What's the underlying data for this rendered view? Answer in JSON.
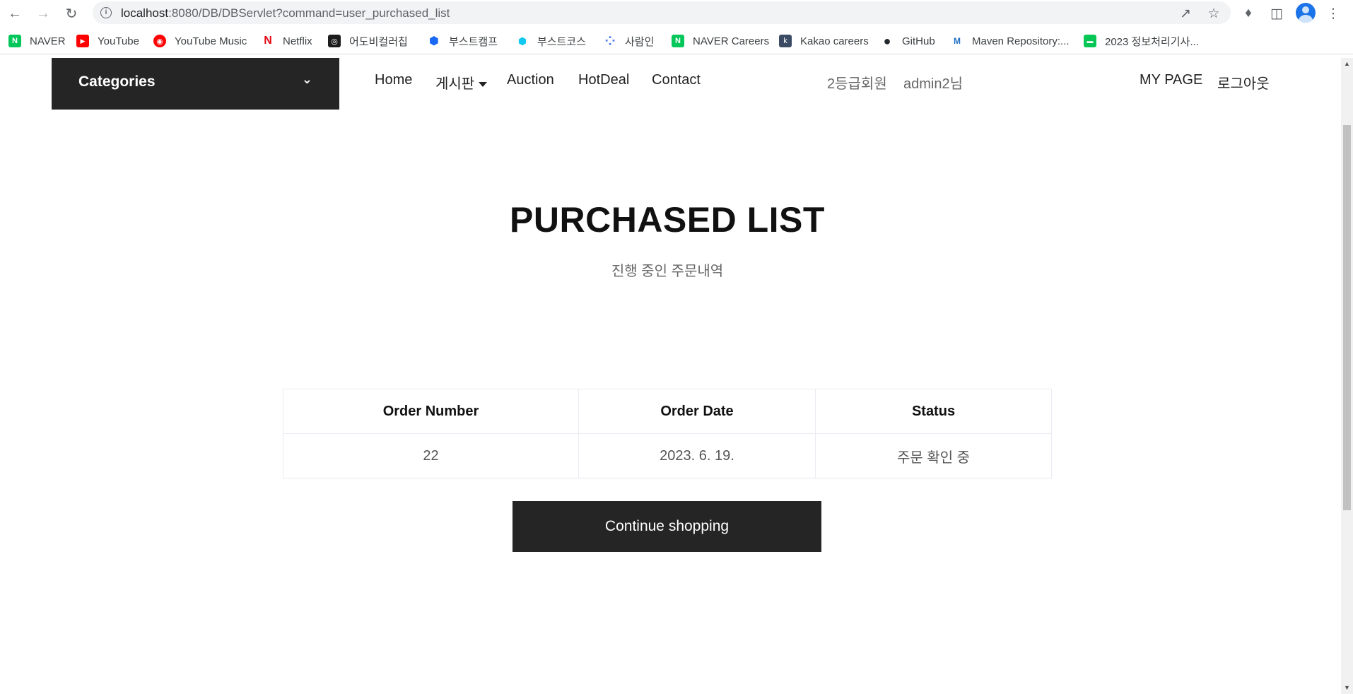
{
  "browser": {
    "url_host": "localhost",
    "url_path": ":8080/DB/DBServlet?command=user_purchased_list",
    "bookmarks": [
      {
        "label": "NAVER",
        "icon": "naver-icon",
        "color": "#03c75a",
        "glyph": "N"
      },
      {
        "label": "YouTube",
        "icon": "youtube-icon",
        "color": "#ff0000",
        "glyph": "▶"
      },
      {
        "label": "YouTube Music",
        "icon": "youtube-music-icon",
        "color": "#ff0000",
        "glyph": "◉"
      },
      {
        "label": "Netflix",
        "icon": "netflix-icon",
        "color": "#e50914",
        "glyph": "N"
      },
      {
        "label": "어도비컬러칩",
        "icon": "adobe-color-icon",
        "color": "#1c1c1c",
        "glyph": "◎"
      },
      {
        "label": "부스트캠프",
        "icon": "boostcamp-icon",
        "color": "#1868f5",
        "glyph": "⬢"
      },
      {
        "label": "부스트코스",
        "icon": "boostcourse-icon",
        "color": "#11c9f0",
        "glyph": "⬢"
      },
      {
        "label": "사람인",
        "icon": "saramin-icon",
        "color": "#4876ef",
        "glyph": "⁘"
      },
      {
        "label": "NAVER Careers",
        "icon": "naver-careers-icon",
        "color": "#03c75a",
        "glyph": "N"
      },
      {
        "label": "Kakao careers",
        "icon": "kakao-careers-icon",
        "color": "#3c4b64",
        "glyph": "k"
      },
      {
        "label": "GitHub",
        "icon": "github-icon",
        "color": "#24292f",
        "glyph": "●"
      },
      {
        "label": "Maven Repository:...",
        "icon": "maven-icon",
        "color": "#1f6fc5",
        "glyph": "M"
      },
      {
        "label": "2023 정보처리기사...",
        "icon": "line-icon",
        "color": "#06c755",
        "glyph": "▬"
      }
    ]
  },
  "header": {
    "categories_label": "Categories",
    "menu": [
      {
        "label": "Home"
      },
      {
        "label": "게시판"
      },
      {
        "label": "Auction"
      },
      {
        "label": "HotDeal"
      },
      {
        "label": "Contact"
      }
    ],
    "member_grade": "2등급회원",
    "username": "admin2님",
    "my_page": "MY PAGE",
    "logout": "로그아웃"
  },
  "main": {
    "title": "PURCHASED LIST",
    "subtitle": "진행 중인 주문내역",
    "table": {
      "headers": [
        "Order Number",
        "Order Date",
        "Status"
      ],
      "rows": [
        [
          "22",
          "2023. 6. 19.",
          "주문 확인 중"
        ]
      ]
    },
    "continue_label": "Continue shopping"
  },
  "colors": {
    "dark": "#252525",
    "muted": "#666666"
  }
}
